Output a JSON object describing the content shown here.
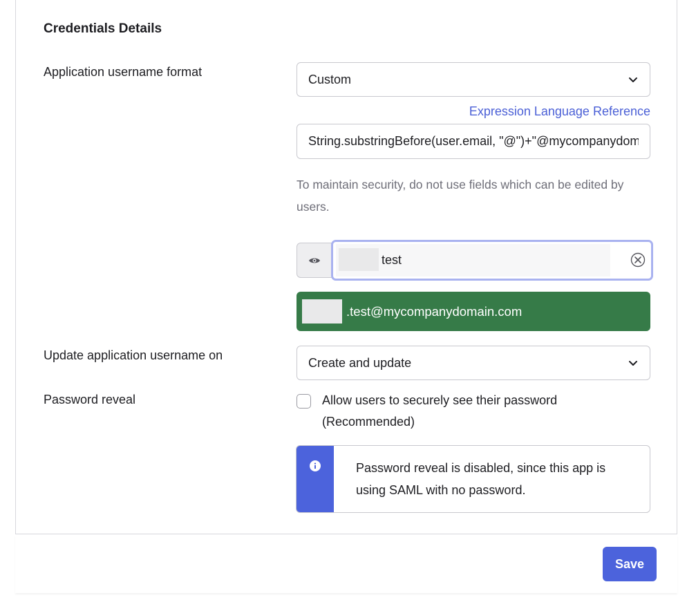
{
  "section": {
    "title": "Credentials Details"
  },
  "username_format": {
    "label": "Application username format",
    "selected": "Custom",
    "reference_link": "Expression Language Reference",
    "expression_value": "String.substringBefore(user.email, \"@\")+\"@mycompanydomain.com\"",
    "hint": "To maintain security, do not use fields which can be edited by users."
  },
  "preview": {
    "test_user_value": "test",
    "result": ".test@mycompanydomain.com"
  },
  "update_on": {
    "label": "Update application username on",
    "selected": "Create and update"
  },
  "password_reveal": {
    "label": "Password reveal",
    "checked": false,
    "checkbox_label": "Allow users to securely see their password (Recommended)",
    "info_message": "Password reveal is disabled, since this app is using SAML with no password."
  },
  "footer": {
    "save_label": "Save"
  },
  "colors": {
    "accent": "#4c63dc",
    "success": "#367b48",
    "link": "#4a5fd6",
    "focus_ring": "#a9b2f0"
  },
  "icons": {
    "select_chevron": "chevron-down-icon",
    "preview_toggle": "eye-icon",
    "clear": "close-icon",
    "info": "info-icon"
  }
}
